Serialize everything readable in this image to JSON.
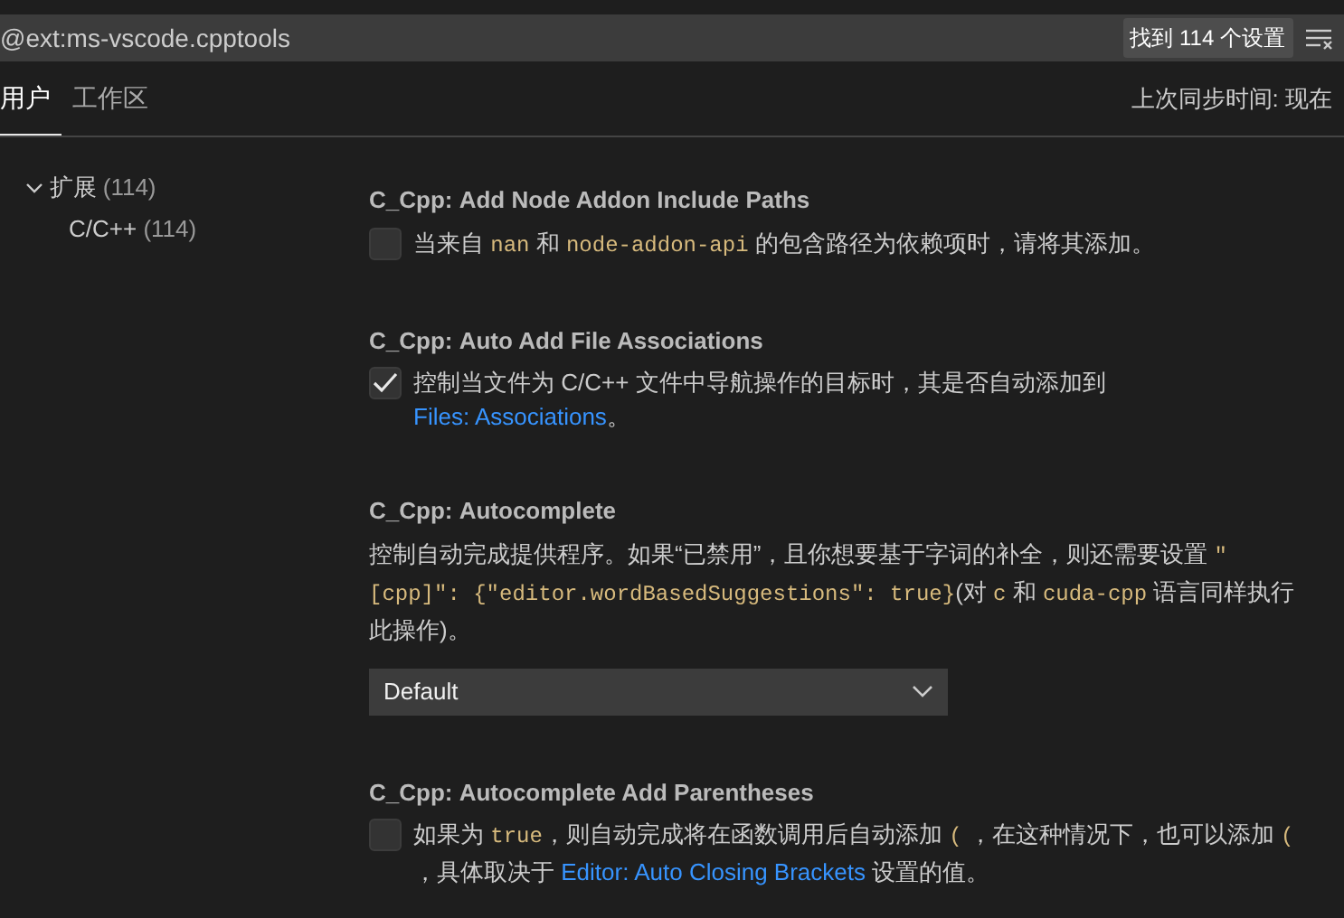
{
  "search": {
    "value": "@ext:ms-vscode.cpptools",
    "count": "找到 114 个设置"
  },
  "tabs": [
    {
      "label": "用户",
      "selected": true
    },
    {
      "label": "工作区",
      "selected": false
    }
  ],
  "sync_status": "上次同步时间: 现在",
  "tree": [
    {
      "label": "扩展",
      "count": "(114)",
      "expanded": true,
      "children": [
        {
          "label": "C/C++",
          "count": "(114)"
        }
      ]
    }
  ],
  "settings": [
    {
      "kind": "checkbox",
      "title": "C_Cpp: **Add Node Addon Include Paths**",
      "checked": false,
      "description": [
        {
          "kind": "text",
          "text": "当来自 "
        },
        {
          "kind": "code",
          "text": "nan"
        },
        {
          "kind": "text",
          "text": " 和 "
        },
        {
          "kind": "code",
          "text": "node-addon-api"
        },
        {
          "kind": "text",
          "text": " 的包含路径为依赖项时，请将其添加。"
        }
      ]
    },
    {
      "kind": "checkbox",
      "title": "C_Cpp: **Auto Add File Associations**",
      "checked": true,
      "description": [
        {
          "kind": "text",
          "text": "控制当文件为 C/C++ 文件中导航操作的目标时，其是否自动添加到 "
        },
        {
          "kind": "link",
          "text": "Files: Associations"
        },
        {
          "kind": "text",
          "text": "。"
        }
      ]
    },
    {
      "kind": "dropdown",
      "title": "C_Cpp: **Autocomplete**",
      "value": "Default",
      "description": [
        {
          "kind": "text",
          "text": "控制自动完成提供程序。如果“已禁用”，且你想要基于字词的补全，则还需要设置 "
        },
        {
          "kind": "code",
          "text": "\"[cpp]\": {\"editor.wordBasedSuggestions\": true}"
        },
        {
          "kind": "text",
          "text": "(对 "
        },
        {
          "kind": "code",
          "text": "c"
        },
        {
          "kind": "text",
          "text": " 和 "
        },
        {
          "kind": "code",
          "text": "cuda-cpp"
        },
        {
          "kind": "text",
          "text": " 语言同样执行此操作)。"
        }
      ]
    },
    {
      "kind": "checkbox",
      "title": "C_Cpp: **Autocomplete Add Parentheses**",
      "checked": false,
      "description": [
        {
          "kind": "text",
          "text": "如果为 "
        },
        {
          "kind": "code",
          "text": "true"
        },
        {
          "kind": "text",
          "text": "，则自动完成将在函数调用后自动添加 "
        },
        {
          "kind": "code",
          "text": "("
        },
        {
          "kind": "text",
          "text": " ，在这种情况下，也可以添加 "
        },
        {
          "kind": "code",
          "text": "("
        },
        {
          "kind": "text",
          "text": " ，具体取决于 "
        },
        {
          "kind": "link",
          "text": "Editor: Auto Closing Brackets"
        },
        {
          "kind": "text",
          "text": " 设置的值。"
        }
      ]
    }
  ]
}
